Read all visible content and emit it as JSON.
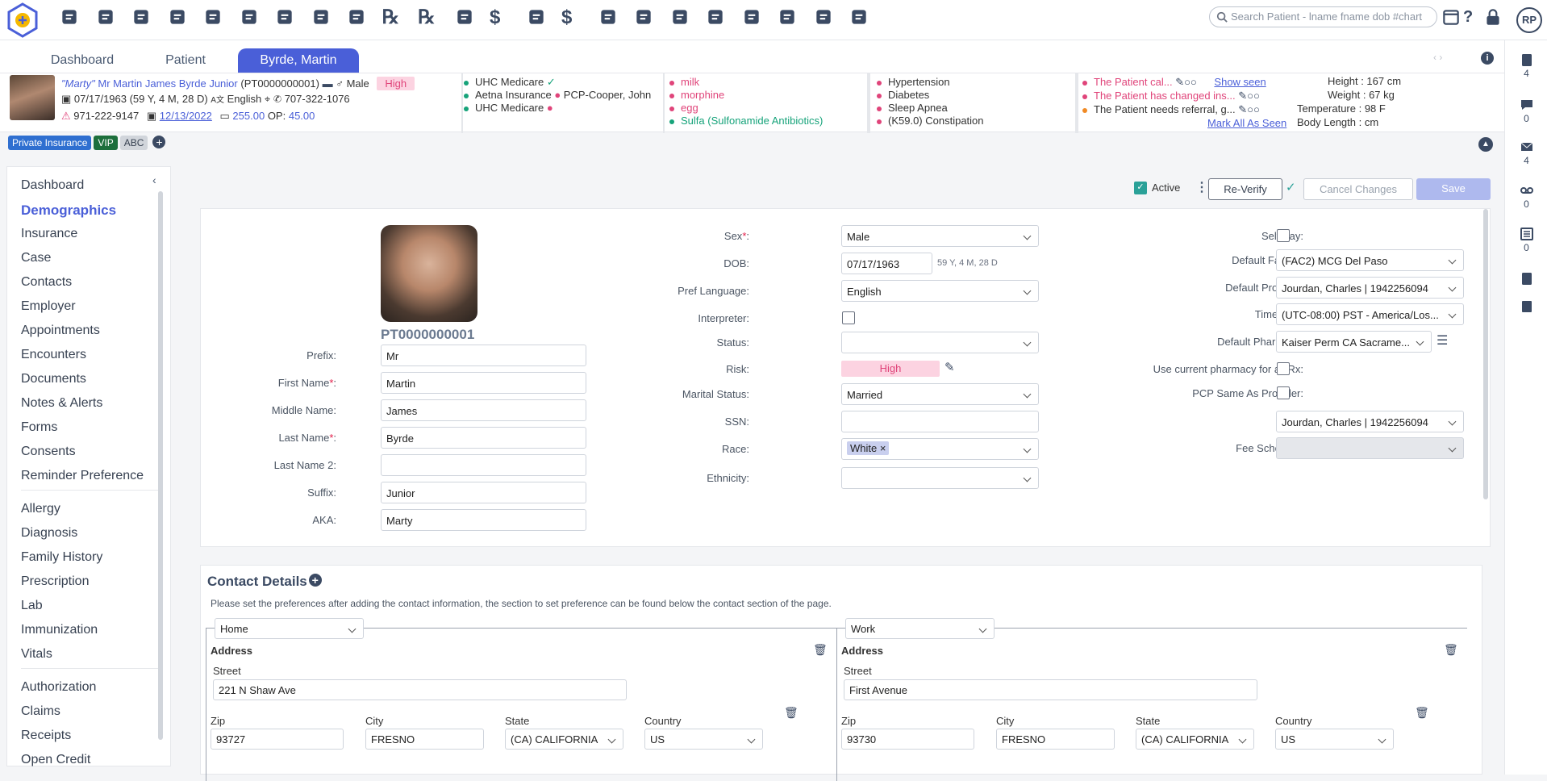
{
  "topbar": {
    "search_placeholder": "Search Patient - lname fname dob #chart",
    "avatar": "RP",
    "icons": [
      "gear-icon",
      "search-icon",
      "user-icon",
      "calendar-icon",
      "user-shield-icon",
      "shield-check-icon",
      "sign-in-icon",
      "clipboard-plus-icon",
      "flask-icon",
      "rx-icon",
      "rx-refill-icon",
      "document-icon",
      "dollar-icon",
      "invoice-dollar-icon",
      "dollar-transfer-icon",
      "hand-holding-icon",
      "envelope-dollar-icon",
      "hands-dollar-icon",
      "money-bag-icon",
      "receipt-icon",
      "book-icon",
      "briefcase-icon",
      "chart-icon"
    ]
  },
  "tabs": {
    "dashboard": "Dashboard",
    "patient": "Patient",
    "active": "Byrde, Martin"
  },
  "patient": {
    "nickname": "\"Marty\"",
    "name": "Mr Martin James Byrde Junior",
    "id": "(PT0000000001)",
    "sex": "Male",
    "risk": "High",
    "dob": "07/17/1963 (59 Y, 4 M, 28 D)",
    "language": "English",
    "phone": "707-322-1076",
    "alt_phone": "971-222-9147",
    "visit_date": "12/13/2022",
    "balance": "255.00",
    "op_label": "OP:",
    "op_value": "45.00"
  },
  "insurance": [
    "UHC Medicare",
    "Aetna Insurance",
    "UHC Medicare"
  ],
  "pcp": "PCP-Cooper, John",
  "allergies": [
    "milk",
    "morphine",
    "egg",
    "Sulfa (Sulfonamide Antibiotics)"
  ],
  "problems": [
    "Hypertension",
    "Diabetes",
    "Sleep Apnea",
    "(K59.0) Constipation"
  ],
  "alerts": {
    "items": [
      "The Patient cal...",
      "The Patient has changed ins...",
      "The Patient needs referral, g..."
    ],
    "show_seen": "Show seen",
    "mark_all": "Mark All As Seen"
  },
  "vitals": {
    "height_label": "Height",
    "height": "167 cm",
    "weight_label": "Weight",
    "weight": "67 kg",
    "temp_label": "Temperature",
    "temp": "98 F",
    "body_label": "Body Length",
    "body": "cm"
  },
  "tags": [
    "Private Insurance",
    "VIP",
    "ABC"
  ],
  "rightbar": {
    "c1": "4",
    "c2": "0",
    "c3": "4",
    "c4": "0",
    "c5": "0"
  },
  "nav": {
    "g1": [
      "Dashboard",
      "Demographics",
      "Insurance",
      "Case",
      "Contacts",
      "Employer",
      "Appointments",
      "Encounters",
      "Documents",
      "Notes & Alerts",
      "Forms",
      "Consents",
      "Reminder Preference"
    ],
    "g2": [
      "Allergy",
      "Diagnosis",
      "Family History",
      "Prescription",
      "Lab",
      "Immunization",
      "Vitals"
    ],
    "g3": [
      "Authorization",
      "Claims",
      "Receipts",
      "Open Credit"
    ]
  },
  "actions": {
    "active": "Active",
    "reverify": "Re-Verify",
    "cancel": "Cancel Changes",
    "save": "Save"
  },
  "form": {
    "chart_no": "PT0000000001",
    "prefix_label": "Prefix:",
    "prefix": "Mr",
    "first_label": "First Name",
    "first": "Martin",
    "middle_label": "Middle Name:",
    "middle": "James",
    "last_label": "Last Name",
    "last": "Byrde",
    "last2_label": "Last Name 2:",
    "last2": "",
    "suffix_label": "Suffix:",
    "suffix": "Junior",
    "aka_label": "AKA:",
    "aka": "Marty",
    "sex_label": "Sex",
    "sex": "Male",
    "dob_label": "DOB:",
    "dob": "07/17/1963",
    "age": "59 Y, 4 M, 28 D",
    "lang_label": "Pref Language:",
    "lang": "English",
    "interp_label": "Interpreter:",
    "status_label": "Status:",
    "status": "",
    "risk_label": "Risk:",
    "risk": "High",
    "marital_label": "Marital Status:",
    "marital": "Married",
    "ssn_label": "SSN:",
    "ssn": "",
    "race_label": "Race:",
    "race": "White",
    "eth_label": "Ethnicity:",
    "eth": "",
    "selfpay_label": "Self Pay:",
    "facility_label": "Default Facility:",
    "facility": "(FAC2) MCG Del Paso",
    "provider_label": "Default Provider:",
    "provider": "Jourdan, Charles | 1942256094",
    "tz_label": "Timezone:",
    "tz": "(UTC-08:00) PST - America/Los...",
    "pharm_label": "Default Pharmacy:",
    "pharm": "Kaiser Perm CA Sacrame...",
    "usepharm_label": "Use current pharmacy for all Rx:",
    "pcpsame_label": "PCP Same As Provider:",
    "pcp_label": "PCP:",
    "pcp": "Jourdan, Charles | 1942256094",
    "fee_label": "Fee Schedule:",
    "fee": ""
  },
  "contact": {
    "title": "Contact Details",
    "note": "Please set the preferences after adding the contact information, the section to set preference can be found below the contact section of the page.",
    "cards": [
      {
        "type": "Home",
        "address": "Address",
        "street_label": "Street",
        "street": "221 N Shaw Ave",
        "zip_label": "Zip",
        "zip": "93727",
        "city_label": "City",
        "city": "FRESNO",
        "state_label": "State",
        "state": "(CA) CALIFORNIA",
        "country_label": "Country",
        "country": "US"
      },
      {
        "type": "Work",
        "address": "Address",
        "street_label": "Street",
        "street": "First Avenue",
        "zip_label": "Zip",
        "zip": "93730",
        "city_label": "City",
        "city": "FRESNO",
        "state_label": "State",
        "state": "(CA) CALIFORNIA",
        "country_label": "Country",
        "country": "US"
      }
    ]
  }
}
